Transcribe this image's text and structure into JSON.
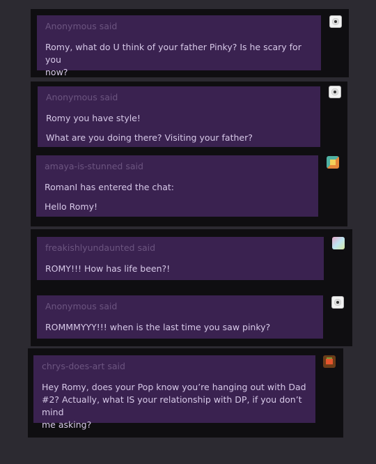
{
  "posts": [
    {
      "sender": "Anonymous",
      "said": "said",
      "avatar": "anonymous-avatar-icon",
      "lines": [
        "Romy, what do U think of your father Pinky? Is he scary for you",
        "now?"
      ]
    },
    {
      "sender": "Anonymous",
      "said": "said",
      "avatar": "anonymous-avatar-icon",
      "lines": [
        "Romy you have style!",
        "What are you doing there? Visiting your father?"
      ]
    },
    {
      "sender": "amaya-is-stunned",
      "said": "said",
      "avatar": "user-avatar-icon",
      "lines": [
        "RomanI has entered the chat:",
        "Hello Romy!"
      ]
    },
    {
      "sender": "freakishlyundaunted",
      "said": "said",
      "avatar": "user-avatar-icon",
      "lines": [
        "ROMY!!! How has life been?!"
      ]
    },
    {
      "sender": "Anonymous",
      "said": "said",
      "avatar": "anonymous-avatar-icon",
      "lines": [
        "ROMMMYYY!!! when is the last time you saw pinky?"
      ]
    },
    {
      "sender": "chrys-does-art",
      "said": "said",
      "avatar": "user-avatar-icon",
      "lines": [
        "Hey Romy, does your Pop know you’re hanging out with Dad",
        "#2? Actually, what IS your relationship with DP, if you don’t mind",
        "me asking?"
      ]
    }
  ]
}
